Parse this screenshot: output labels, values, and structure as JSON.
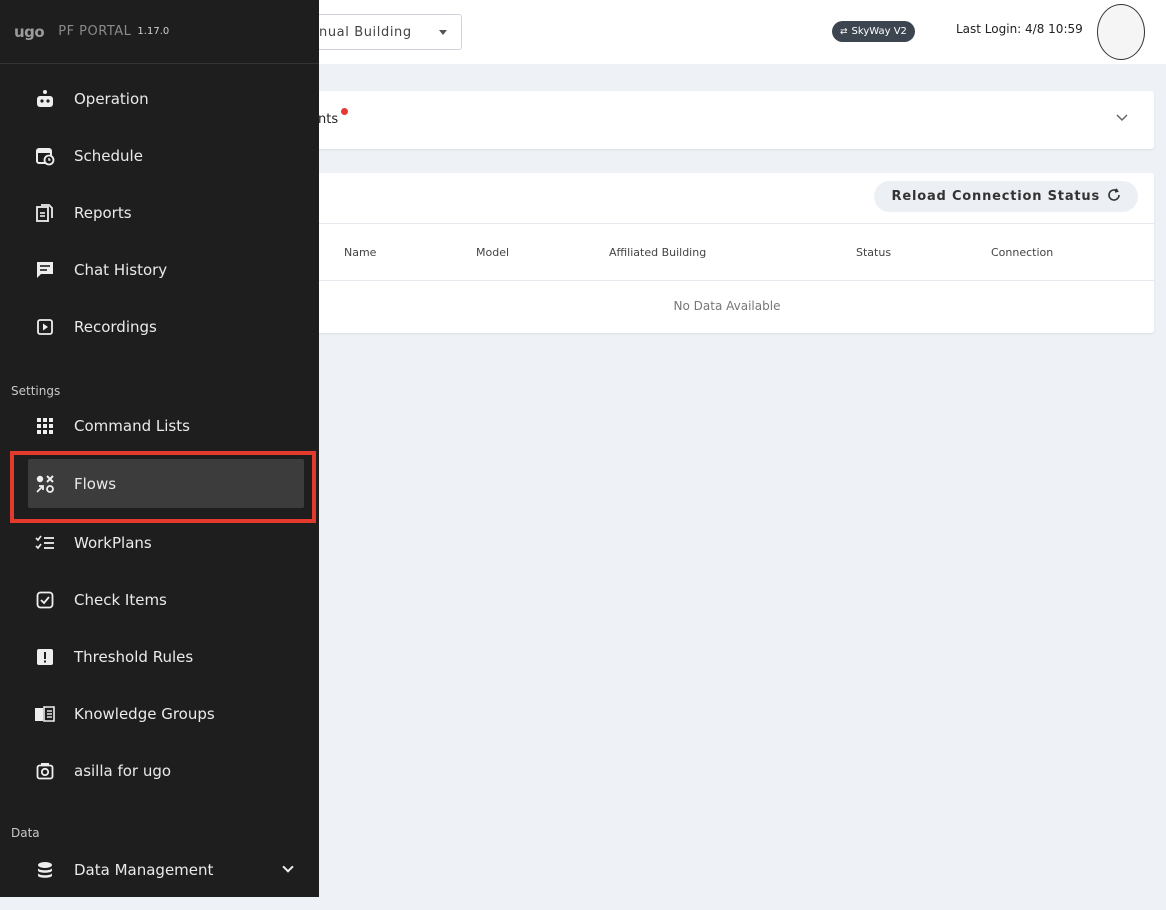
{
  "header": {
    "logo": "ugo",
    "portal_name": "PF PORTAL",
    "version": "1.17.0",
    "building_select": "nual Building",
    "skyway_badge": "SkyWay V2",
    "last_login": "Last Login: 4/8 10:59"
  },
  "sidebar": {
    "items": [
      {
        "label": "Operation",
        "icon": "robot-icon"
      },
      {
        "label": "Schedule",
        "icon": "calendar-clock-icon"
      },
      {
        "label": "Reports",
        "icon": "document-icon"
      },
      {
        "label": "Chat History",
        "icon": "chat-icon"
      },
      {
        "label": "Recordings",
        "icon": "play-icon"
      }
    ],
    "settings_title": "Settings",
    "settings_items": [
      {
        "label": "Command Lists",
        "icon": "grid-icon"
      },
      {
        "label": "Flows",
        "icon": "flows-icon"
      },
      {
        "label": "WorkPlans",
        "icon": "checklist-icon"
      },
      {
        "label": "Check Items",
        "icon": "checkbox-icon"
      },
      {
        "label": "Threshold Rules",
        "icon": "alert-icon"
      },
      {
        "label": "Knowledge Groups",
        "icon": "book-icon"
      },
      {
        "label": "asilla for ugo",
        "icon": "camera-icon"
      }
    ],
    "data_title": "Data",
    "data_items": [
      {
        "label": "Data Management",
        "icon": "database-icon"
      }
    ]
  },
  "collapsible": {
    "label": "nts"
  },
  "table": {
    "reload_label": "Reload Connection Status",
    "columns": [
      "Name",
      "Model",
      "Affiliated Building",
      "Status",
      "Connection"
    ],
    "empty_text": "No Data Available"
  },
  "colors": {
    "sidebar_bg": "#1e1e1e",
    "active_bg": "#3c3c3c",
    "highlight": "#e23b2e",
    "page_bg": "#eef2f7"
  }
}
